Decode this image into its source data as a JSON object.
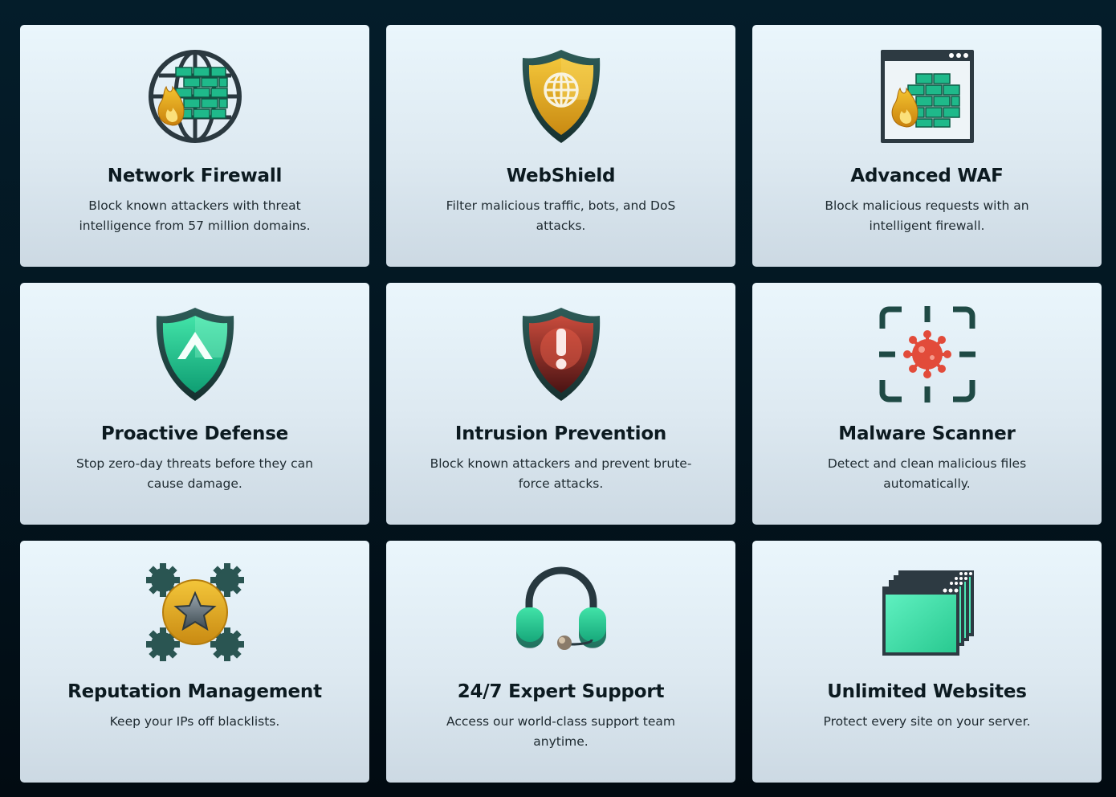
{
  "features": [
    {
      "title": "Network Firewall",
      "description": "Block known attackers with threat intelligence from 57 million domains.",
      "icon": "globe-firewall-icon"
    },
    {
      "title": "WebShield",
      "description": "Filter malicious traffic, bots, and DoS attacks.",
      "icon": "shield-globe-icon"
    },
    {
      "title": "Advanced WAF",
      "description": "Block malicious requests with an intelligent firewall.",
      "icon": "browser-firewall-icon"
    },
    {
      "title": "Proactive Defense",
      "description": "Stop zero-day threats before they can cause damage.",
      "icon": "shield-arrow-up-icon"
    },
    {
      "title": "Intrusion Prevention",
      "description": "Block known attackers and prevent brute-force attacks.",
      "icon": "shield-alert-icon"
    },
    {
      "title": "Malware Scanner",
      "description": "Detect and clean malicious files automatically.",
      "icon": "virus-scan-icon"
    },
    {
      "title": "Reputation Management",
      "description": "Keep your IPs off blacklists.",
      "icon": "star-gears-icon"
    },
    {
      "title": "24/7 Expert Support",
      "description": "Access our world-class support team anytime.",
      "icon": "headset-icon"
    },
    {
      "title": "Unlimited Websites",
      "description": "Protect every site on your server.",
      "icon": "stacked-windows-icon"
    }
  ],
  "colors": {
    "background": "#031621",
    "card": "#e2eef5",
    "accent_green": "#1fb98a",
    "accent_gold": "#e0a81a",
    "dark_teal": "#1f3b3e",
    "alert_red": "#c0392b"
  }
}
